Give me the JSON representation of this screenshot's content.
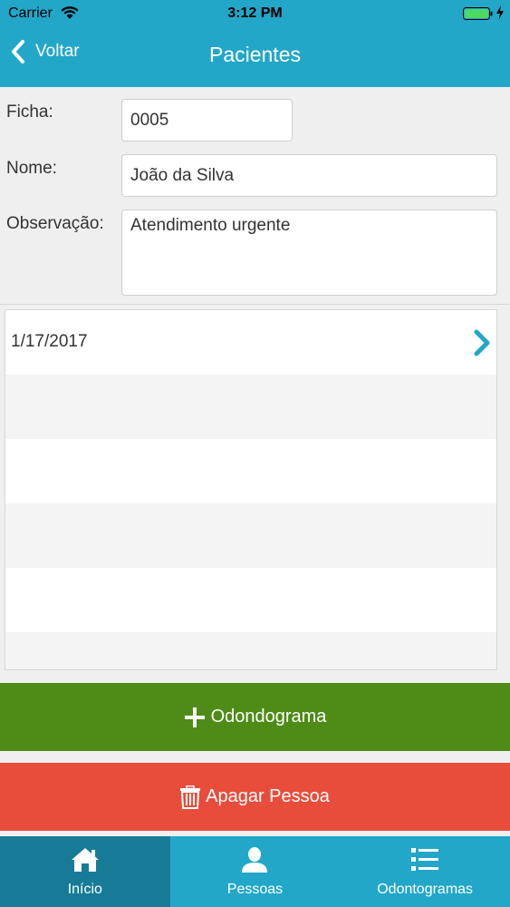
{
  "status_bar": {
    "carrier": "Carrier",
    "time": "3:12 PM"
  },
  "nav": {
    "back_label": "Voltar",
    "title": "Pacientes"
  },
  "form": {
    "ficha_label": "Ficha:",
    "ficha_value": "0005",
    "nome_label": "Nome:",
    "nome_value": "João da Silva",
    "observacao_label": "Observação:",
    "observacao_value": "Atendimento urgente"
  },
  "list": {
    "items": [
      "1/17/2017"
    ]
  },
  "buttons": {
    "add_label": "Odondograma",
    "delete_label": "Apagar Pessoa"
  },
  "tabbar": {
    "tabs": [
      {
        "label": "Início",
        "icon": "home-icon"
      },
      {
        "label": "Pessoas",
        "icon": "person-icon"
      },
      {
        "label": "Odontogramas",
        "icon": "list-icon"
      }
    ],
    "active_index": 0
  },
  "colors": {
    "header": "#22a7c9",
    "active_tab": "#177b98",
    "add_button": "#4e8c17",
    "delete_button": "#e84d3c",
    "chevron": "#22a7c9",
    "battery": "#4cd964"
  }
}
